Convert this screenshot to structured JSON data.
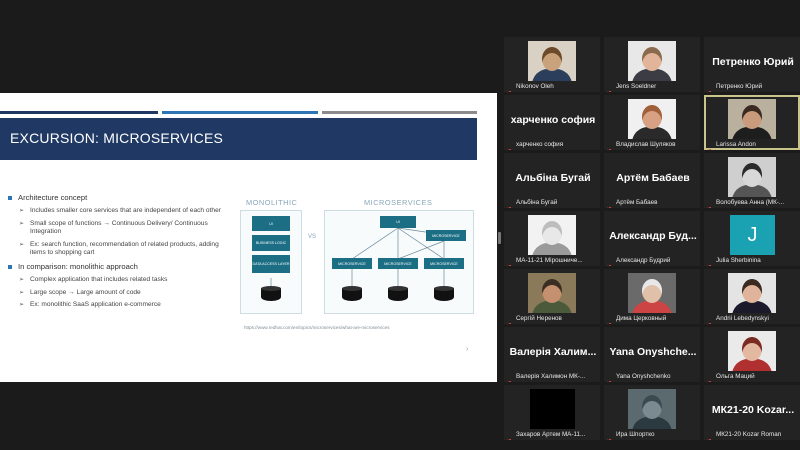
{
  "slide": {
    "title": "EXCURSION: MICROSERVICES",
    "bullets": [
      {
        "text": "Architecture concept",
        "sub": [
          "Includes smaller core services that are independent of each other",
          "Small scope of functions → Continuous Delivery/ Continuous Integration",
          "Ex: search function, recommendation of related products, adding items to shopping cart"
        ]
      },
      {
        "text": "In comparison: monolithic approach",
        "sub": [
          "Complex application that includes related tasks",
          "Large scope → Large amount of code",
          "Ex: monolithic SaaS application e-commerce"
        ]
      }
    ],
    "diagram": {
      "monolithic_label": "MONOLITHIC",
      "microservices_label": "MICROSERVICES",
      "vs": "VS",
      "ui": "UI",
      "business_logic": "BUSINESS LOGIC",
      "data_access": "DATA ACCESS LAYER",
      "microservice": "MICROSERVICE"
    },
    "source_url": "https://www.redhat.com/en/topics/microservices/what-are-microservices",
    "nav_arrow": "›"
  },
  "participants": [
    {
      "name": "Nikonov Oleh",
      "type": "video",
      "skin": "#c9a27c",
      "hair": "#6b4a2b",
      "shirt": "#2b3e5c",
      "bg": "#d9d2c4"
    },
    {
      "name": "Jens Soeldner",
      "type": "video",
      "skin": "#e2b59a",
      "hair": "#8a6a4c",
      "shirt": "#3c3c44",
      "bg": "#e8e8e8"
    },
    {
      "name": "Петренко Юрий",
      "type": "name",
      "big": "Петренко Юрий"
    },
    {
      "name": "харченко софия",
      "type": "name",
      "big": "харченко софия"
    },
    {
      "name": "Владислав Шуляков",
      "type": "video",
      "skin": "#d9a184",
      "hair": "#a0603a",
      "shirt": "#2a2a2a",
      "bg": "#f0f0f0"
    },
    {
      "name": "Larissa Andon",
      "type": "video",
      "skin": "#c99a7c",
      "hair": "#3a2a22",
      "shirt": "#1e1e1e",
      "bg": "#b9b09e",
      "active": true
    },
    {
      "name": "Альбіна Бугай",
      "type": "name",
      "big": "Альбіна Бугай"
    },
    {
      "name": "Артём Бабаев",
      "type": "name",
      "big": "Артём Бабаев"
    },
    {
      "name": "Волобуева Анна (МК-...",
      "type": "video",
      "skin": "#d8d8d8",
      "hair": "#2a2a2a",
      "shirt": "#555555",
      "bg": "#cfcfcf"
    },
    {
      "name": "МА-11-21 Мірошниче...",
      "type": "video",
      "skin": "#e8e8e8",
      "hair": "#bdbdbd",
      "shirt": "#9a9a9a",
      "bg": "#f2f2f2"
    },
    {
      "name": "Александр Будрий",
      "type": "name",
      "big": "Александр Буд..."
    },
    {
      "name": "Julia Sherbinina",
      "type": "letter",
      "letter": "J"
    },
    {
      "name": "Сергій Неренов",
      "type": "video",
      "skin": "#c59070",
      "hair": "#3a2d22",
      "shirt": "#4a5a3a",
      "bg": "#8a7a5a"
    },
    {
      "name": "Дима Церковный",
      "type": "video",
      "skin": "#e0c0a8",
      "hair": "#e8e8e8",
      "shirt": "#c44",
      "bg": "#6a6a6a"
    },
    {
      "name": "Andrii Lebedynskyi",
      "type": "video",
      "skin": "#e0b49a",
      "hair": "#3a2a20",
      "shirt": "#1a1a2a",
      "bg": "#e4e4e4"
    },
    {
      "name": "Валерія Халимон МК-...",
      "type": "name",
      "big": "Валерія Халим..."
    },
    {
      "name": "Yana Onyshchenko",
      "type": "name",
      "big": "Yana Onyshche..."
    },
    {
      "name": "Ольга Маций",
      "type": "video",
      "skin": "#e2b8a0",
      "hair": "#7a2a20",
      "shirt": "#b03030",
      "bg": "#eaeaea"
    },
    {
      "name": "Захаров Артем МА-11...",
      "type": "black"
    },
    {
      "name": "Ира Шпортко",
      "type": "video",
      "skin": "#7a8a90",
      "hair": "#3a4a50",
      "shirt": "#2a3a40",
      "bg": "#5a6a6e"
    },
    {
      "name": "МК21-20 Kozar Roman",
      "type": "name",
      "big": "МК21-20 Kozar..."
    }
  ]
}
